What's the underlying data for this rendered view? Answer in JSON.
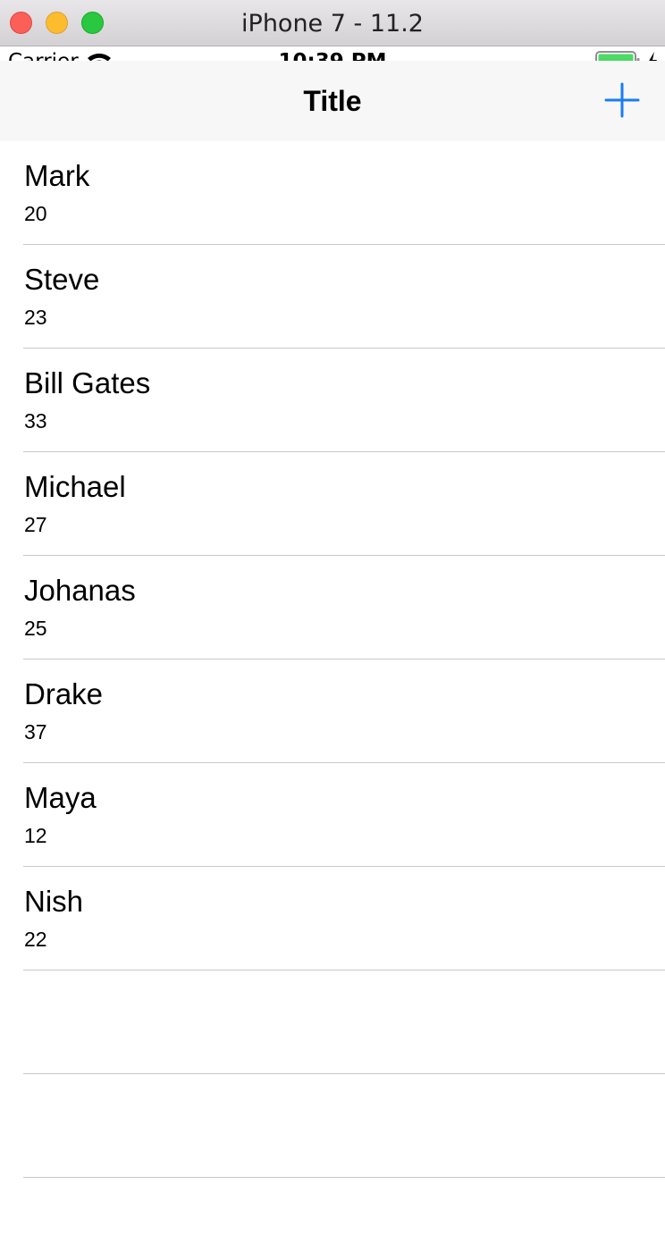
{
  "window": {
    "title": "iPhone 7 - 11.2"
  },
  "status_bar": {
    "carrier": "Carrier",
    "time": "10:39 PM",
    "battery_color": "#4cd964"
  },
  "nav": {
    "title": "Title",
    "add_icon": "plus-icon",
    "tint_color": "#1a7cf4"
  },
  "people": [
    {
      "name": "Mark",
      "age": "20"
    },
    {
      "name": "Steve",
      "age": "23"
    },
    {
      "name": "Bill Gates",
      "age": "33"
    },
    {
      "name": "Michael",
      "age": "27"
    },
    {
      "name": "Johanas",
      "age": "25"
    },
    {
      "name": "Drake",
      "age": "37"
    },
    {
      "name": "Maya",
      "age": "12"
    },
    {
      "name": "Nish",
      "age": "22"
    },
    {
      "name": "",
      "age": ""
    },
    {
      "name": "",
      "age": ""
    }
  ]
}
